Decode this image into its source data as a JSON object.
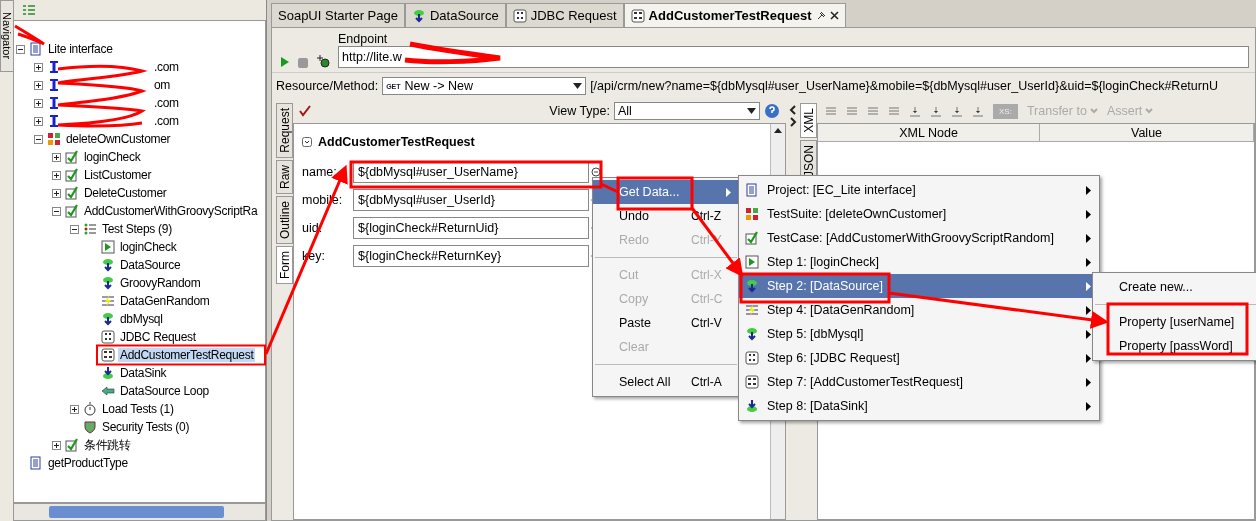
{
  "navigator": {
    "tab_label": "Navigator"
  },
  "tree": [
    {
      "label": "Lite interface",
      "kind": "project",
      "selected": false,
      "expanded": true,
      "children": [
        {
          "label": ".com",
          "kind": "interface",
          "selected": false,
          "expanded": false
        },
        {
          "label": "om",
          "kind": "interface",
          "selected": false,
          "expanded": false
        },
        {
          "label": ".com",
          "kind": "interface",
          "selected": false,
          "expanded": false
        },
        {
          "label": ".com",
          "kind": "interface",
          "selected": false,
          "expanded": false
        },
        {
          "label": "deleteOwnCustomer",
          "kind": "suite",
          "selected": false,
          "expanded": true,
          "children": [
            {
              "label": "loginCheck",
              "kind": "case",
              "selected": false,
              "expanded": false
            },
            {
              "label": "ListCustomer",
              "kind": "case",
              "selected": false,
              "expanded": false
            },
            {
              "label": "DeleteCustomer",
              "kind": "case",
              "selected": false,
              "expanded": false
            },
            {
              "label": "AddCustomerWithGroovyScriptRa",
              "kind": "case",
              "selected": false,
              "expanded": true,
              "children": [
                {
                  "label": "Test Steps (9)",
                  "kind": "steps",
                  "selected": false,
                  "expanded": true,
                  "children": [
                    {
                      "label": "loginCheck",
                      "kind": "request",
                      "selected": false
                    },
                    {
                      "label": "DataSource",
                      "kind": "datasource",
                      "selected": false
                    },
                    {
                      "label": "GroovyRandom",
                      "kind": "datasource",
                      "selected": false
                    },
                    {
                      "label": "DataGenRandom",
                      "kind": "datagen",
                      "selected": false
                    },
                    {
                      "label": "dbMysql",
                      "kind": "datasource",
                      "selected": false
                    },
                    {
                      "label": "JDBC Request",
                      "kind": "jdbc",
                      "selected": false
                    },
                    {
                      "label": "AddCustomerTestRequest",
                      "kind": "rest",
                      "selected": true
                    },
                    {
                      "label": "DataSink",
                      "kind": "datasink",
                      "selected": false
                    },
                    {
                      "label": "DataSource Loop",
                      "kind": "loop",
                      "selected": false
                    }
                  ]
                },
                {
                  "label": "Load Tests (1)",
                  "kind": "load",
                  "selected": false,
                  "expanded": false
                },
                {
                  "label": "Security Tests (0)",
                  "kind": "security",
                  "selected": false
                }
              ]
            },
            {
              "label": "条件跳转",
              "kind": "case",
              "selected": false,
              "expanded": false
            }
          ]
        }
      ]
    },
    {
      "label": "getProductType",
      "kind": "project",
      "selected": false
    }
  ],
  "editor_tabs": [
    {
      "label": "SoapUI Starter Page",
      "kind": "page",
      "selected": false
    },
    {
      "label": "DataSource",
      "kind": "datasource",
      "selected": false
    },
    {
      "label": "JDBC Request",
      "kind": "jdbc",
      "selected": false
    },
    {
      "label": "AddCustomerTestRequest",
      "kind": "rest",
      "selected": true
    }
  ],
  "endpoint": {
    "label": "Endpoint",
    "value": "http://lite.w"
  },
  "resource": {
    "label": "Resource/Method:",
    "method": "GET",
    "value": "New -> New",
    "path": "[/api/crm/new?name=${dbMysql#user_UserName}&mobile=${dbMysql#user_UserId}&uid=${loginCheck#ReturnU"
  },
  "request": {
    "side_tabs": [
      {
        "label": "Request",
        "selected": false
      },
      {
        "label": "Raw",
        "selected": false
      },
      {
        "label": "Outline",
        "selected": false
      },
      {
        "label": "Form",
        "selected": true
      }
    ],
    "view_type_label": "View Type:",
    "view_type": "All",
    "title": "AddCustomerTestRequest",
    "params": [
      {
        "name": "name:",
        "value": "${dbMysql#user_UserName}"
      },
      {
        "name": "mobile:",
        "value": "${dbMysql#user_UserId}"
      },
      {
        "name": "uid:",
        "value": "${loginCheck#ReturnUid}"
      },
      {
        "name": "key:",
        "value": "${loginCheck#ReturnKey}"
      }
    ]
  },
  "response": {
    "side_tabs": [
      {
        "label": "XML",
        "selected": true
      },
      {
        "label": "JSON",
        "selected": false
      }
    ],
    "xs_label": "XS:",
    "buttons": [
      {
        "label": "Transfer to",
        "disabled": true
      },
      {
        "label": "Assert",
        "disabled": true
      }
    ],
    "columns": [
      "XML Node",
      "Value"
    ]
  },
  "context_menu": [
    {
      "kind": "item",
      "label": "Get Data...",
      "submenu": true,
      "selected": true,
      "disabled": false
    },
    {
      "kind": "item",
      "label": "Undo",
      "shortcut": "Ctrl-Z",
      "submenu": false,
      "selected": false,
      "disabled": false
    },
    {
      "kind": "item",
      "label": "Redo",
      "shortcut": "Ctrl-Y",
      "submenu": false,
      "selected": false,
      "disabled": true
    },
    {
      "kind": "separator"
    },
    {
      "kind": "item",
      "label": "Cut",
      "shortcut": "Ctrl-X",
      "submenu": false,
      "selected": false,
      "disabled": true
    },
    {
      "kind": "item",
      "label": "Copy",
      "shortcut": "Ctrl-C",
      "submenu": false,
      "selected": false,
      "disabled": true
    },
    {
      "kind": "item",
      "label": "Paste",
      "shortcut": "Ctrl-V",
      "submenu": false,
      "selected": false,
      "disabled": false
    },
    {
      "kind": "item",
      "label": "Clear",
      "submenu": false,
      "selected": false,
      "disabled": true
    },
    {
      "kind": "separator"
    },
    {
      "kind": "item",
      "label": "Select All",
      "shortcut": "Ctrl-A",
      "submenu": false,
      "selected": false,
      "disabled": false
    }
  ],
  "get_data_menu": [
    {
      "label": "Project: [EC_Lite interface]",
      "kind": "project",
      "selected": false
    },
    {
      "label": "TestSuite: [deleteOwnCustomer]",
      "kind": "suite",
      "selected": false
    },
    {
      "label": "TestCase: [AddCustomerWithGroovyScriptRandom]",
      "kind": "case",
      "selected": false
    },
    {
      "label": "Step 1: [loginCheck]",
      "kind": "request",
      "selected": false
    },
    {
      "label": "Step 2: [DataSource]",
      "kind": "datasource",
      "selected": true
    },
    {
      "label": "Step 4: [DataGenRandom]",
      "kind": "datagen",
      "selected": false
    },
    {
      "label": "Step 5: [dbMysql]",
      "kind": "datasource",
      "selected": false
    },
    {
      "label": "Step 6: [JDBC Request]",
      "kind": "jdbc",
      "selected": false
    },
    {
      "label": "Step 7: [AddCustomerTestRequest]",
      "kind": "rest",
      "selected": false
    },
    {
      "label": "Step 8: [DataSink]",
      "kind": "datasink",
      "selected": false
    }
  ],
  "property_menu": [
    {
      "kind": "item",
      "label": "Create new..."
    },
    {
      "kind": "separator"
    },
    {
      "kind": "item",
      "label": "Property [userName]"
    },
    {
      "kind": "item",
      "label": "Property [passWord]"
    }
  ]
}
